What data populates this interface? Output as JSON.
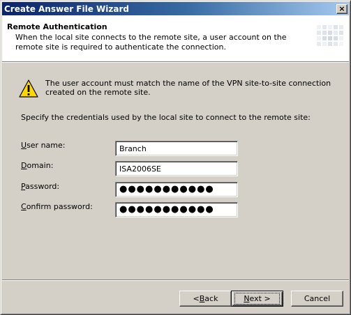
{
  "window": {
    "title": "Create Answer File Wizard",
    "close_glyph": "×"
  },
  "header": {
    "title": "Remote Authentication",
    "subtitle": "When the local site connects to the remote site, a user account on the remote site is required to authenticate the connection.",
    "graphic_icon": "wizard-header-graphic"
  },
  "warning": {
    "icon": "warning-icon",
    "text": "The user account must match the name of the VPN site-to-site connection created on the remote site."
  },
  "instruction": "Specify the credentials used by the local site to connect to the remote site:",
  "form": {
    "username": {
      "label_prefix": "",
      "label_access": "U",
      "label_rest": "ser name:",
      "value": "Branch"
    },
    "domain": {
      "label_prefix": "",
      "label_access": "D",
      "label_rest": "omain:",
      "value": "ISA2006SE"
    },
    "password": {
      "label_prefix": "",
      "label_access": "P",
      "label_rest": "assword:",
      "value": "●●●●●●●●●●●"
    },
    "confirm_password": {
      "label_prefix": "",
      "label_access": "C",
      "label_rest": "onfirm password:",
      "value": "●●●●●●●●●●●"
    }
  },
  "buttons": {
    "back": {
      "prefix": "< ",
      "access": "B",
      "rest": "ack"
    },
    "next": {
      "prefix": "",
      "access": "N",
      "rest": "ext >"
    },
    "cancel": {
      "label": "Cancel"
    }
  },
  "colors": {
    "titlebar_start": "#0a246a",
    "titlebar_end": "#a6caf0",
    "dialog_face": "#d4d0c8",
    "warning_yellow": "#ffd800"
  }
}
